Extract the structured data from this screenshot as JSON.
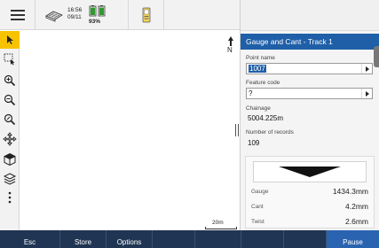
{
  "status": {
    "time": "16:56",
    "date": "09/11",
    "battery_percent": "93%"
  },
  "icons": {
    "menu": "menu-icon",
    "receiver": "satellite-receiver-icon",
    "battery": "battery-icon",
    "controller": "controller-device-icon"
  },
  "toolbar": {
    "tools": [
      "select-arrow-icon",
      "box-select-icon",
      "zoom-in-icon",
      "zoom-out-icon",
      "zoom-extents-icon",
      "pan-icon",
      "3d-view-icon",
      "layers-icon",
      "more-icon"
    ],
    "active_index": 0
  },
  "map": {
    "north_label": "N",
    "scale_label": "20m"
  },
  "panel": {
    "title": "Gauge and Cant - Track 1",
    "point_name_label": "Point name",
    "point_name_value": "1007",
    "feature_code_label": "Feature code",
    "feature_code_value": "?",
    "chainage_label": "Chainage",
    "chainage_value": "5004.225m",
    "records_label": "Number of records",
    "records_value": "109",
    "gauge_label": "Gauge",
    "gauge_value": "1434.3mm",
    "cant_label": "Cant",
    "cant_value": "4.2mm",
    "twist_label": "Twist",
    "twist_value": "2.6mm"
  },
  "softkeys": {
    "esc": "Esc",
    "store": "Store",
    "options": "Options",
    "pause": "Pause"
  },
  "colors": {
    "accent_blue": "#1f5fa8",
    "softkey_bar": "#1f3553",
    "active_tool": "#f7c300",
    "battery_green": "#2e9a2e"
  }
}
